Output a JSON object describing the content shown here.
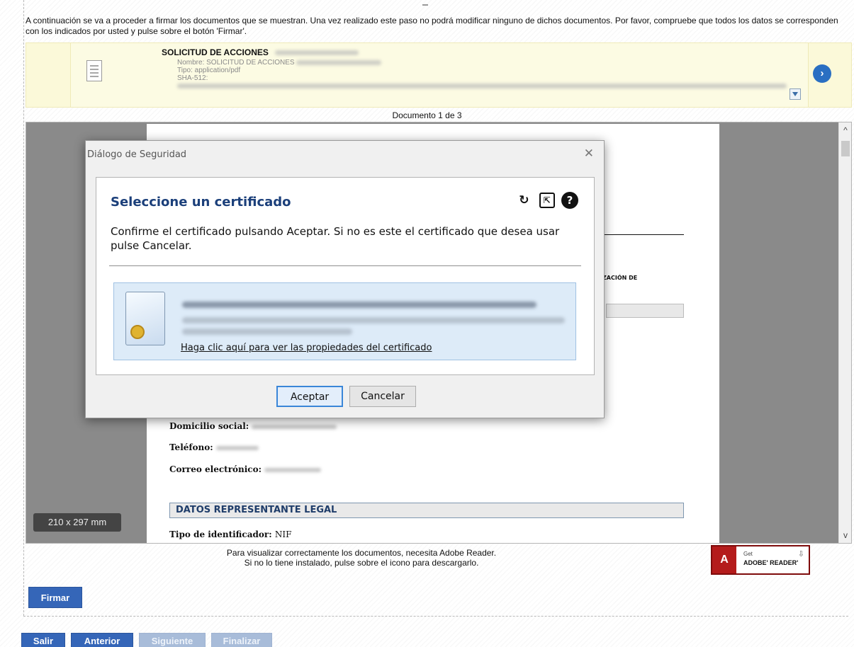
{
  "intro_text": "A continuación se va a proceder a firmar los documentos que se muestran. Una vez realizado este paso no podrá modificar ninguno de dichos documentos. Por favor, compruebe que todos los datos se corresponden con los indicados por usted y pulse sobre el botón 'Firmar'.",
  "document": {
    "title": "SOLICITUD DE ACCIONES",
    "name_line": "Nombre: SOLICITUD DE ACCIONES",
    "type_line": "Tipo: application/pdf",
    "hash_label": "SHA-512:",
    "counter": "Documento 1 de 3"
  },
  "viewer": {
    "page_size": "210 x 297 mm",
    "pdf": {
      "partial_heading": "IZACIÓN DE",
      "domicilio_label": "Domicilio social:",
      "telefono_label": "Teléfono:",
      "correo_label": "Correo electrónico:",
      "section_title": "DATOS REPRESENTANTE LEGAL",
      "tipo_label": "Tipo de identificador:",
      "tipo_value": "NIF"
    }
  },
  "dialog": {
    "title": "Diálogo de Seguridad",
    "close_glyph": "✕",
    "heading": "Seleccione un certificado",
    "message": "Confirme el certificado pulsando Aceptar. Si no es este el certificado que desea usar pulse Cancelar.",
    "cert_link": "Haga clic aquí para ver las propiedades del certificado",
    "accept_label": "Aceptar",
    "cancel_label": "Cancelar",
    "tools": {
      "refresh_glyph": "↻",
      "import_glyph": "⇱",
      "help_glyph": "?"
    }
  },
  "adobe": {
    "note_line1": "Para visualizar correctamente los documentos, necesita Adobe Reader.",
    "note_line2": "Si no lo tiene instalado, pulse sobre el icono para descargarlo.",
    "badge_get": "Get",
    "badge_name": "ADOBE' READER'"
  },
  "actions": {
    "firmar": "Firmar",
    "salir": "Salir",
    "anterior": "Anterior",
    "siguiente": "Siguiente",
    "finalizar": "Finalizar"
  },
  "colors": {
    "primary_button": "#3566b8",
    "disabled_button": "#a8bcd9",
    "doc_band": "#fbf9d9",
    "dialog_heading": "#1b3f7a",
    "cert_card": "#ddebf8"
  }
}
